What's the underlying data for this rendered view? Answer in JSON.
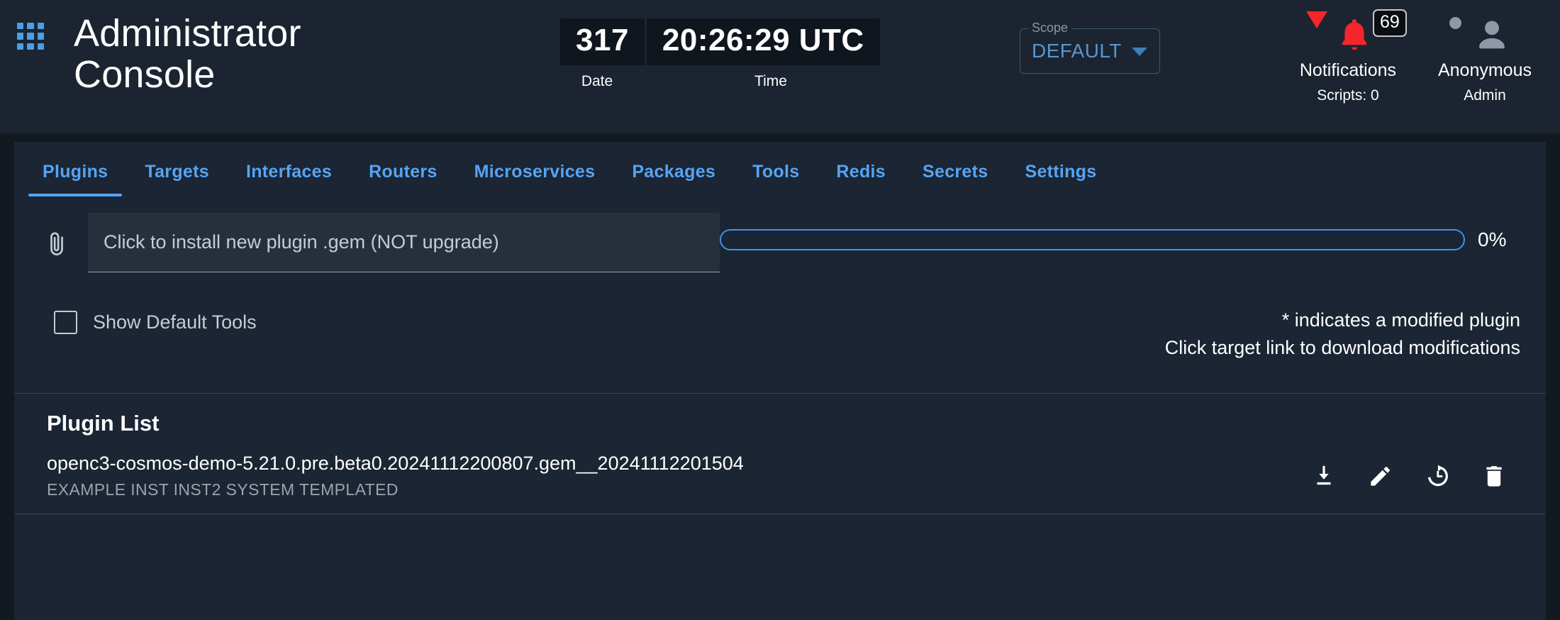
{
  "header": {
    "menu_icon": "apps-grid-icon",
    "title": "Administrator Console",
    "clock": {
      "date_value": "317",
      "time_value": "20:26:29 UTC",
      "date_label": "Date",
      "time_label": "Time"
    },
    "scope": {
      "legend": "Scope",
      "value": "DEFAULT",
      "arrow_icon": "chevron-down-icon"
    },
    "notifications": {
      "caret_icon": "caret-down-icon",
      "bell_icon": "bell-icon",
      "badge_count": "69",
      "label": "Notifications",
      "sub_label": "Scripts: 0"
    },
    "user": {
      "status_icon": "status-dot-icon",
      "avatar_icon": "person-icon",
      "label": "Anonymous",
      "sub_label": "Admin"
    }
  },
  "tabs": [
    {
      "label": "Plugins",
      "active": true
    },
    {
      "label": "Targets",
      "active": false
    },
    {
      "label": "Interfaces",
      "active": false
    },
    {
      "label": "Routers",
      "active": false
    },
    {
      "label": "Microservices",
      "active": false
    },
    {
      "label": "Packages",
      "active": false
    },
    {
      "label": "Tools",
      "active": false
    },
    {
      "label": "Redis",
      "active": false
    },
    {
      "label": "Secrets",
      "active": false
    },
    {
      "label": "Settings",
      "active": false
    }
  ],
  "upload": {
    "clip_icon": "paperclip-icon",
    "field_placeholder": "Click to install new plugin .gem (NOT upgrade)",
    "field_value": "",
    "progress_percent": 0,
    "progress_label": "0%"
  },
  "options": {
    "show_default_tools_label": "Show Default Tools",
    "show_default_tools_checked": false,
    "hint_line_1": "* indicates a modified plugin",
    "hint_line_2": "Click target link to download modifications"
  },
  "plugin_list": {
    "title": "Plugin List",
    "rows": [
      {
        "name": "openc3-cosmos-demo-5.21.0.pre.beta0.20241112200807.gem__20241112201504",
        "targets": "EXAMPLE  INST  INST2  SYSTEM  TEMPLATED",
        "actions": [
          "download-icon",
          "edit-icon",
          "history-icon",
          "delete-icon"
        ]
      }
    ]
  },
  "colors": {
    "accent_blue": "#55a4f5",
    "alert_red": "#f4252b",
    "header_bg": "#1b2430",
    "panel_bg": "#1b2533",
    "page_bg": "#121920"
  }
}
